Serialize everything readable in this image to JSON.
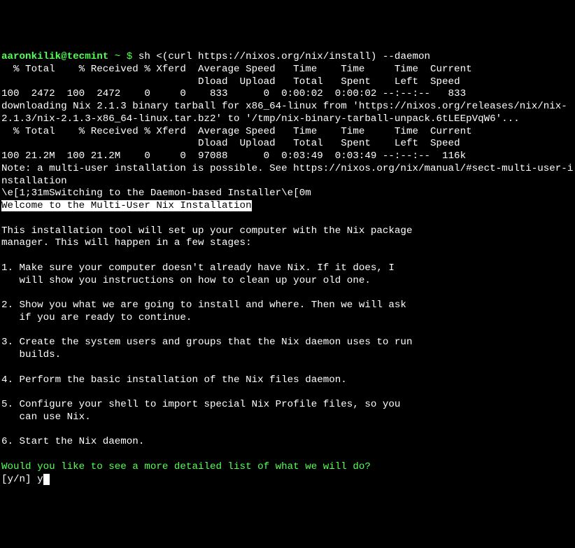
{
  "prompt": {
    "user_host": "aaronkilik@tecmint",
    "separator": " ~ $ ",
    "command": "sh <(curl https://nixos.org/nix/install) --daemon"
  },
  "curl1": {
    "header1": "  % Total    % Received % Xferd  Average Speed   Time    Time     Time  Current",
    "header2": "                                 Dload  Upload   Total   Spent    Left  Speed",
    "line": "100  2472  100  2472    0     0    833      0  0:00:02  0:00:02 --:--:--   833"
  },
  "download_msg": "downloading Nix 2.1.3 binary tarball for x86_64-linux from 'https://nixos.org/releases/nix/nix-2.1.3/nix-2.1.3-x86_64-linux.tar.bz2' to '/tmp/nix-binary-tarball-unpack.6tLEEpVqW6'...",
  "curl2": {
    "header1": "  % Total    % Received % Xferd  Average Speed   Time    Time     Time  Current",
    "header2": "                                 Dload  Upload   Total   Spent    Left  Speed",
    "line": "100 21.2M  100 21.2M    0     0  97088      0  0:03:49  0:03:49 --:--:--  116k"
  },
  "note": "Note: a multi-user installation is possible. See https://nixos.org/nix/manual/#sect-multi-user-installation",
  "escape_line": "\\e[1;31mSwitching to the Daemon-based Installer\\e[0m",
  "welcome": "Welcome to the Multi-User Nix Installation",
  "intro1": "This installation tool will set up your computer with the Nix package",
  "intro2": "manager. This will happen in a few stages:",
  "step1a": "1. Make sure your computer doesn't already have Nix. If it does, I",
  "step1b": "   will show you instructions on how to clean up your old one.",
  "step2a": "2. Show you what we are going to install and where. Then we will ask",
  "step2b": "   if you are ready to continue.",
  "step3a": "3. Create the system users and groups that the Nix daemon uses to run",
  "step3b": "   builds.",
  "step4": "4. Perform the basic installation of the Nix files daemon.",
  "step5a": "5. Configure your shell to import special Nix Profile files, so you",
  "step5b": "   can use Nix.",
  "step6": "6. Start the Nix daemon.",
  "question": "Would you like to see a more detailed list of what we will do?",
  "answer_prompt": "[y/n] ",
  "answer_input": "y"
}
